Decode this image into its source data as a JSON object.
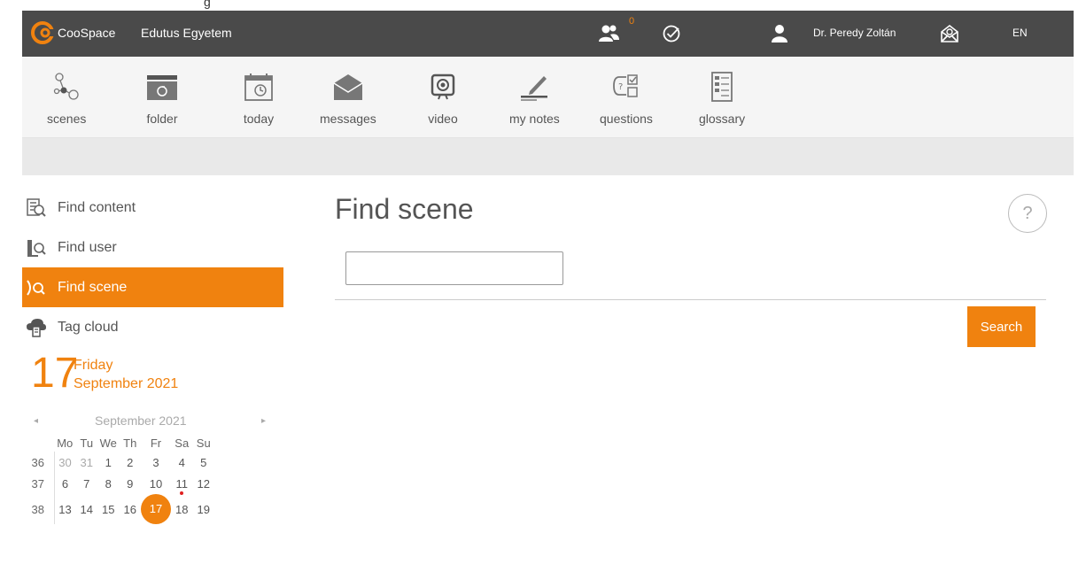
{
  "window_title_fragment": "g",
  "header": {
    "brand": "CooSpace",
    "school": "Edutus Egyetem",
    "notification_count": "0",
    "user_name": "Dr. Peredy Zoltán",
    "language": "EN"
  },
  "toolbar": {
    "items": [
      {
        "label": "scenes",
        "icon": "scenes-icon"
      },
      {
        "label": "folder",
        "icon": "folder-icon"
      },
      {
        "label": "today",
        "icon": "today-icon"
      },
      {
        "label": "messages",
        "icon": "messages-icon"
      },
      {
        "label": "video",
        "icon": "video-icon"
      },
      {
        "label": "my notes",
        "icon": "notes-icon"
      },
      {
        "label": "questions",
        "icon": "questions-icon"
      },
      {
        "label": "glossary",
        "icon": "glossary-icon"
      }
    ]
  },
  "sidebar": {
    "items": [
      {
        "label": "Find content"
      },
      {
        "label": "Find user"
      },
      {
        "label": "Find scene"
      },
      {
        "label": "Tag cloud"
      }
    ]
  },
  "date": {
    "day": "17",
    "weekday": "Friday",
    "month_year": "September 2021"
  },
  "calendar": {
    "title": "September 2021",
    "prev": "◂",
    "next": "▸",
    "weekdays": [
      "Mo",
      "Tu",
      "We",
      "Th",
      "Fr",
      "Sa",
      "Su"
    ],
    "weeks": [
      {
        "num": "36",
        "days": [
          "30",
          "31",
          "1",
          "2",
          "3",
          "4",
          "5"
        ]
      },
      {
        "num": "37",
        "days": [
          "6",
          "7",
          "8",
          "9",
          "10",
          "11",
          "12"
        ]
      },
      {
        "num": "38",
        "days": [
          "13",
          "14",
          "15",
          "16",
          "17",
          "18",
          "19"
        ]
      }
    ],
    "selected_day": "17",
    "event_day": "11"
  },
  "main": {
    "title": "Find scene",
    "help": "?",
    "search_value": "",
    "search_button": "Search"
  },
  "colors": {
    "accent": "#f0820f",
    "header_bg": "#4a4a4a"
  }
}
